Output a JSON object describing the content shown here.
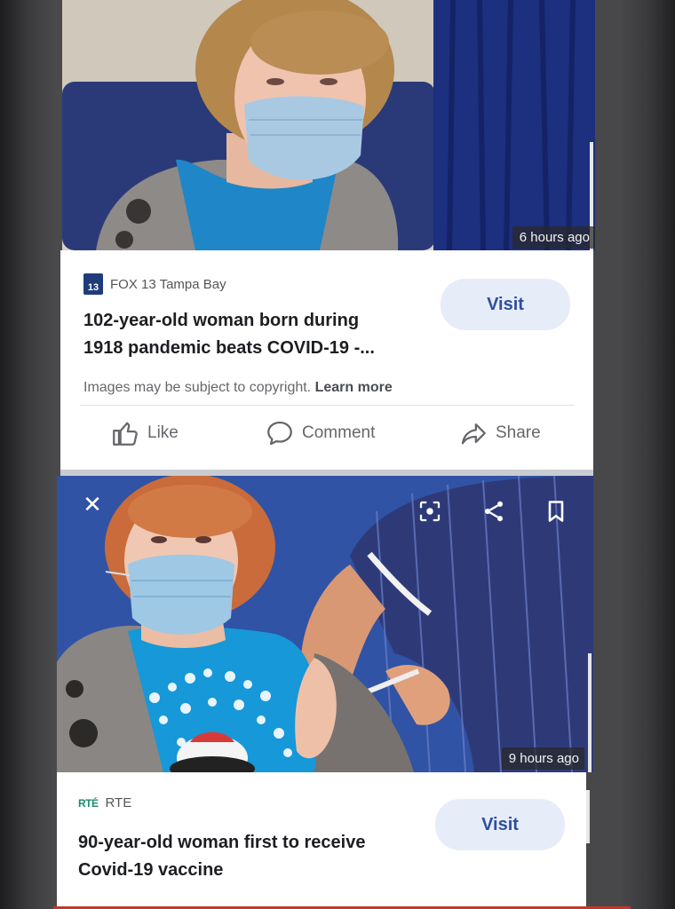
{
  "post1": {
    "time_ago": "6 hours ago",
    "source": "FOX 13 Tampa Bay",
    "source_logo_text": "13",
    "headline_line1": "102-year-old woman born during",
    "headline_line2": "1918 pandemic beats COVID-19 -...",
    "visit_label": "Visit",
    "copyright_text": "Images may be subject to copyright.",
    "learn_more": "Learn more",
    "like_label": "Like",
    "comment_label": "Comment",
    "share_label": "Share"
  },
  "post2": {
    "time_ago": "9 hours ago",
    "source_logo_text": "RTÉ",
    "source": "RTE",
    "headline_line1": "90-year-old woman first to receive",
    "headline_line2": "Covid-19 vaccine",
    "visit_label": "Visit"
  },
  "colors": {
    "accent": "#2d4f9f",
    "visit_bg": "#e7ecf9",
    "fox_blue": "#1f3b7a",
    "rte_green": "#1a8c6e"
  }
}
